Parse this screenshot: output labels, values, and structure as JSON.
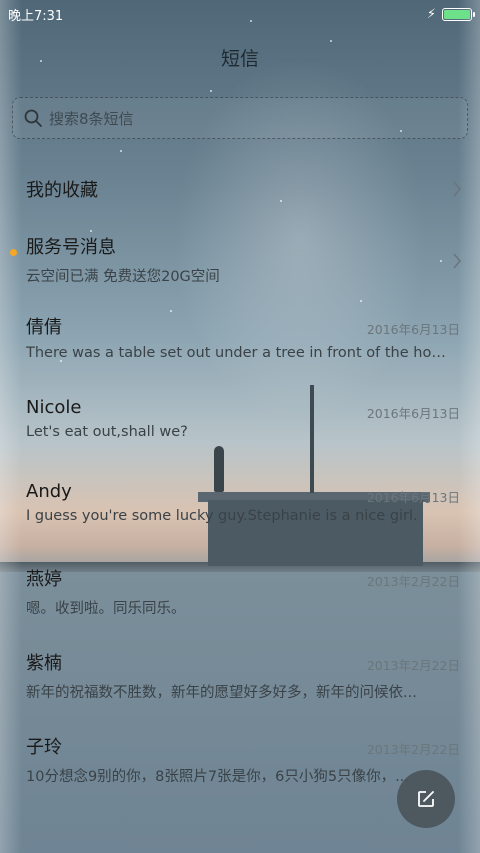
{
  "status_bar": {
    "time": "晚上7:31",
    "battery_color": "#6de08a"
  },
  "header": {
    "title": "短信"
  },
  "search": {
    "placeholder": "搜索8条短信"
  },
  "accent_color": "#f5a623",
  "favorites": {
    "label": "我的收藏"
  },
  "service": {
    "name": "服务号消息",
    "preview": "云空间已满 免费送您20G空间",
    "unread": true
  },
  "conversations": [
    {
      "name": "倩倩",
      "preview": "There was a table set out under a tree in front of the hous",
      "date": "2016年6月13日"
    },
    {
      "name": "Nicole",
      "preview": "Let's eat out,shall we?",
      "date": "2016年6月13日"
    },
    {
      "name": "Andy",
      "preview": "I guess you're some lucky guy.Stephanie is a nice girl.",
      "date": "2016年6月13日"
    },
    {
      "name": "燕婷",
      "preview": "嗯。收到啦。同乐同乐。",
      "date": "2013年2月22日"
    },
    {
      "name": "紫楠",
      "preview": "新年的祝福数不胜数，新年的愿望好多好多，新年的问候依...",
      "date": "2013年2月22日"
    },
    {
      "name": "子玲",
      "preview": "10分想念9别的你，8张照片7张是你，6只小狗5只像你，...",
      "date": "2013年2月22日"
    }
  ],
  "icons": {
    "search": "search-icon",
    "chevron": "chevron-right-icon",
    "compose": "compose-icon",
    "charging": "charging-bolt-icon"
  }
}
